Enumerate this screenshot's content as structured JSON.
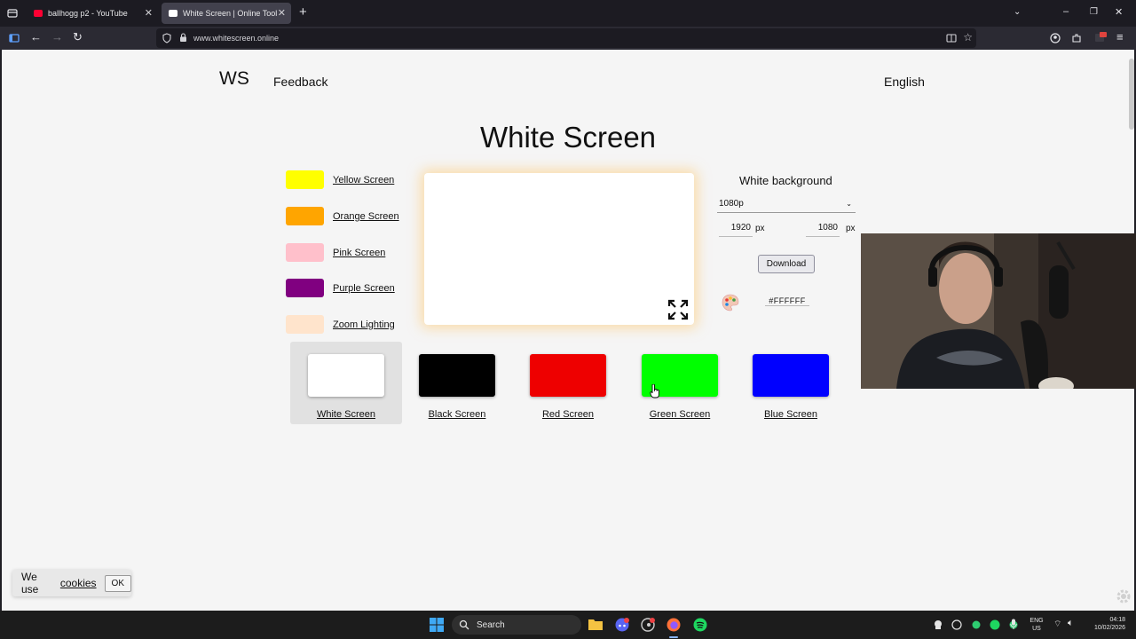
{
  "browser": {
    "tabs": [
      {
        "label": "ballhogg p2 - YouTube"
      },
      {
        "label": "White Screen | Online Tool"
      }
    ],
    "url": "www.whitescreen.online"
  },
  "site": {
    "logo": "WS",
    "nav_feedback": "Feedback",
    "language": "English",
    "title": "White Screen"
  },
  "side_colors": [
    {
      "label": "Yellow Screen",
      "color": "#ffff00"
    },
    {
      "label": "Orange Screen",
      "color": "#ffa500"
    },
    {
      "label": "Pink Screen",
      "color": "#ffc0cb"
    },
    {
      "label": "Purple Screen",
      "color": "#800080"
    },
    {
      "label": "Zoom Lighting",
      "color": "#ffe4cc"
    }
  ],
  "panel": {
    "title": "White background",
    "resolution": "1080p",
    "width": "1920",
    "height": "1080",
    "unit": "px",
    "download": "Download",
    "hex": "#FFFFFF"
  },
  "color_cards": [
    {
      "label": "White Screen",
      "color": "#ffffff"
    },
    {
      "label": "Black Screen",
      "color": "#000000"
    },
    {
      "label": "Red Screen",
      "color": "#ee0000"
    },
    {
      "label": "Green Screen",
      "color": "#00ff00"
    },
    {
      "label": "Blue Screen",
      "color": "#0000ff"
    }
  ],
  "cookie": {
    "text": "We use",
    "link": "cookies",
    "ok": "OK"
  },
  "taskbar": {
    "search": "Search",
    "lang_top": "ENG",
    "lang_bottom": "US",
    "time": "04:18",
    "date": "10/02/2026"
  }
}
